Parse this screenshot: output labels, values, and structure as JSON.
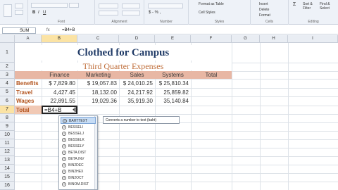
{
  "ribbon": {
    "font_group": "Font",
    "alignment_group": "Alignment",
    "number_group": "Number",
    "styles_group": "Styles",
    "cells_group": "Cells",
    "editing_group": "Editing",
    "format_as_table": "Format as Table",
    "cell_styles": "Cell Styles",
    "insert": "Insert",
    "delete": "Delete",
    "format": "Format",
    "sort_filter": "Sort & Filter",
    "find_select": "Find & Select"
  },
  "formula_bar": {
    "name_box": "SUM",
    "fx": "fx",
    "formula": "=B4+B"
  },
  "columns": [
    "A",
    "B",
    "C",
    "D",
    "E",
    "F",
    "G",
    "H",
    "I"
  ],
  "rows": [
    "1",
    "2",
    "3",
    "4",
    "5",
    "6",
    "7",
    "8",
    "9",
    "10",
    "11",
    "12",
    "13",
    "14",
    "15",
    "16",
    "17",
    "18",
    "19",
    "20",
    "21"
  ],
  "sheet": {
    "title": "Clothed for Campus",
    "subtitle": "Third Quarter Expenses",
    "headers": [
      "Finance",
      "Marketing",
      "Sales",
      "Systems",
      "Total"
    ],
    "labels": [
      "Benefits",
      "Travel",
      "Wages",
      "Total"
    ],
    "values": [
      [
        "$ 7,829.80",
        "$ 19,057.83",
        "$ 24,010.25",
        "$ 25,810.34"
      ],
      [
        "4,427.45",
        "18,132.00",
        "24,217.92",
        "25,859.82"
      ],
      [
        "22,891.55",
        "19,029.36",
        "35,919.30",
        "35,140.84"
      ]
    ],
    "active_entry": "=B4+B"
  },
  "autocomplete": {
    "items": [
      "BAHTTEXT",
      "BESSELI",
      "BESSELJ",
      "BESSELK",
      "BESSELY",
      "BETA.DIST",
      "BETA.INV",
      "BIN2DEC",
      "BIN2HEX",
      "BIN2OCT",
      "BINOM.DIST"
    ],
    "tooltip": "Converts a number to text (baht)"
  },
  "colors": {
    "accent": "#1f3a66",
    "label": "#b3541e",
    "header_band": "#e8b7a4"
  }
}
